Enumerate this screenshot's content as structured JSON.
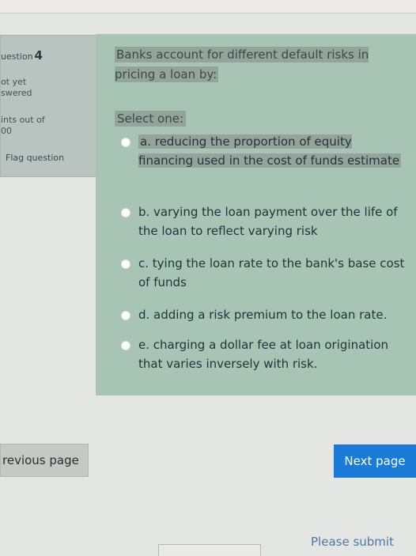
{
  "sidebar": {
    "question_label": "uestion",
    "question_number": "4",
    "status_line1": "ot yet",
    "status_line2": "swered",
    "points_line1": "ints out of",
    "points_line2": "00",
    "flag_label": "Flag question"
  },
  "question": {
    "text": "Banks account for different default risks in pricing a loan by:",
    "select_label": "Select one:"
  },
  "options": [
    {
      "text": "a. reducing the proportion of equity financing used in the cost of funds estimate",
      "selected": false
    },
    {
      "text": "b. varying the loan payment over the life of the loan to reflect varying risk",
      "selected": false
    },
    {
      "text": "c. tying the loan rate to the bank's base cost of funds",
      "selected": false
    },
    {
      "text": "d. adding a risk premium to the loan rate.",
      "selected": false
    },
    {
      "text": "e. charging a dollar fee at loan origination that varies inversely with risk.",
      "selected": false
    }
  ],
  "nav": {
    "prev_label": "revious page",
    "next_label": "Next page",
    "submit_label": "Please submit"
  },
  "colors": {
    "accent": "#1a7ad8",
    "panel": "#a7c4b4"
  }
}
